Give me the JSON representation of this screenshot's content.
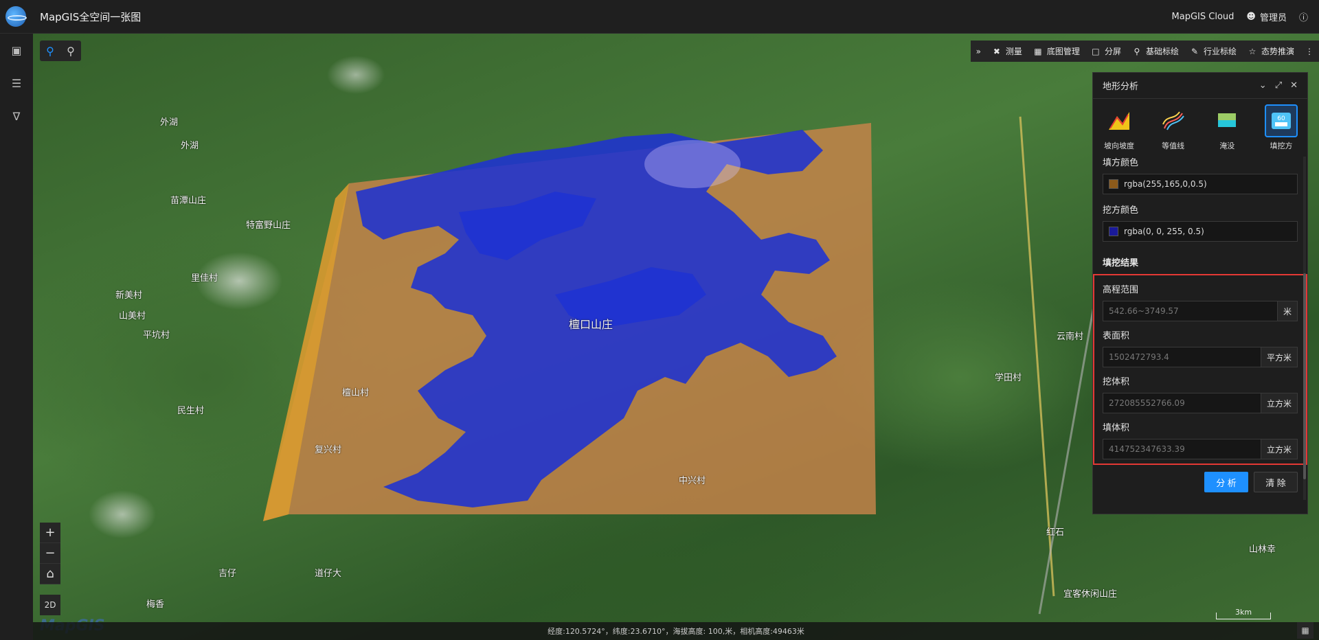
{
  "app": {
    "title": "MapGIS全空间一张图",
    "cloud_label": "MapGIS Cloud",
    "user_label": "管理员"
  },
  "toolbar": {
    "items": [
      {
        "label": "测量",
        "icon": "ruler-icon"
      },
      {
        "label": "底图管理",
        "icon": "grid-icon"
      },
      {
        "label": "分屏",
        "icon": "split-icon"
      },
      {
        "label": "基础标绘",
        "icon": "pin-icon"
      },
      {
        "label": "行业标绘",
        "icon": "pen-icon"
      },
      {
        "label": "态势推演",
        "icon": "star-icon"
      }
    ]
  },
  "map": {
    "places": [
      "外湖",
      "外湖",
      "苗潭山庄",
      "特富野山庄",
      "里佳村",
      "山美村",
      "新美村",
      "平坑村",
      "檀口山庄",
      "檀山村",
      "民生村",
      "复兴村",
      "学田村",
      "云南村",
      "红石",
      "山林幸",
      "道仔大",
      "吉仔",
      "梅香",
      "中兴村",
      "宜客休闲山庄"
    ],
    "status": "经度:120.5724°，纬度:23.6710°，海拔高度: 100,米，相机高度:49463米",
    "scale": "3km",
    "watermark": "MapGIS",
    "btn_2d": "2D"
  },
  "panel": {
    "title": "地形分析",
    "tabs": [
      {
        "label": "坡向坡度",
        "icon": "slope-icon"
      },
      {
        "label": "等值线",
        "icon": "contour-icon"
      },
      {
        "label": "淹没",
        "icon": "flood-icon"
      },
      {
        "label": "填挖方",
        "icon": "cut-fill-icon",
        "badge": "60"
      }
    ],
    "fill_color_label": "填方颜色",
    "fill_color": "rgba(255,165,0,0.5)",
    "cut_color_label": "挖方颜色",
    "cut_color": "rgba(0, 0, 255, 0.5)",
    "result_title": "填挖结果",
    "results": [
      {
        "label": "高程范围",
        "value": "542.66~3749.57",
        "unit": "米"
      },
      {
        "label": "表面积",
        "value": "1502472793.4",
        "unit": "平方米"
      },
      {
        "label": "挖体积",
        "value": "272085552766.09",
        "unit": "立方米"
      },
      {
        "label": "填体积",
        "value": "414752347633.39",
        "unit": "立方米"
      }
    ],
    "analyze_label": "分 析",
    "clear_label": "清 除"
  },
  "colors": {
    "accent": "#1e90ff",
    "fill": "#c8844a",
    "cut": "#1e32d2",
    "highlight": "#e53935"
  }
}
